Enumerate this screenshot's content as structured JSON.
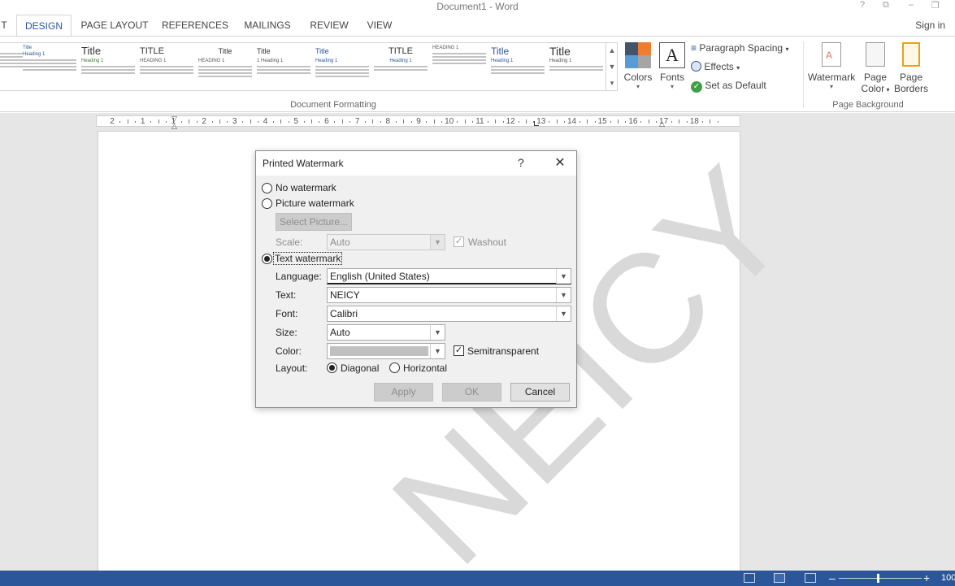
{
  "window": {
    "title": "Document1 - Word",
    "controls": [
      "?",
      "⧉",
      "–",
      "❐"
    ]
  },
  "tabs": [
    "T",
    "DESIGN",
    "PAGE LAYOUT",
    "REFERENCES",
    "MAILINGS",
    "REVIEW",
    "VIEW"
  ],
  "active_tab": "DESIGN",
  "sign_in": "Sign in",
  "ribbon": {
    "style_thumbs": [
      {
        "t1": "",
        "t2": "Title"
      },
      {
        "t1": "Title",
        "t2": "Heading 1"
      },
      {
        "t1": "TITLE",
        "t2": "HEADING 1"
      },
      {
        "t1": "Title",
        "t2": "HEADING 1"
      },
      {
        "t1": "Title",
        "t2": "1 Heading 1"
      },
      {
        "t1": "Title",
        "t2": "Heading 1"
      },
      {
        "t1": "TITLE",
        "t2": "Heading 1"
      },
      {
        "t1": "",
        "t2": "HEADING 1"
      },
      {
        "t1": "TITLE",
        "t2": ""
      },
      {
        "t1": "Title",
        "t2": "Heading 1"
      },
      {
        "t1": "Title",
        "t2": "Heading 1"
      }
    ],
    "colors_label": "Colors",
    "fonts_label": "Fonts",
    "paragraph_spacing_label": "Paragraph Spacing",
    "effects_label": "Effects",
    "set_default_label": "Set as Default",
    "document_formatting_label": "Document Formatting",
    "watermark_label": "Watermark",
    "page_color_label1": "Page",
    "page_color_label2": "Color",
    "page_borders_label1": "Page",
    "page_borders_label2": "Borders",
    "page_background_label": "Page Background"
  },
  "ruler": {
    "labels": [
      "2",
      "1",
      "1",
      "2",
      "3",
      "4",
      "5",
      "6",
      "7",
      "8",
      "9",
      "10",
      "11",
      "12",
      "13",
      "14",
      "15",
      "16",
      "17",
      "18"
    ]
  },
  "watermark_preview_text": "NEICY",
  "dialog": {
    "title": "Printed Watermark",
    "help": "?",
    "close": "✕",
    "no_watermark_label": "No watermark",
    "picture_watermark_label": "Picture watermark",
    "select_picture_label": "Select Picture...",
    "scale_label": "Scale:",
    "scale_value": "Auto",
    "washout_label": "Washout",
    "text_watermark_label": "Text watermark",
    "language_label": "Language:",
    "language_value": "English (United States)",
    "text_label": "Text:",
    "text_value": "NEICY",
    "font_label": "Font:",
    "font_value": "Calibri",
    "size_label": "Size:",
    "size_value": "Auto",
    "color_label": "Color:",
    "color_value_hex": "#c0c0c0",
    "semitransparent_label": "Semitransparent",
    "layout_label": "Layout:",
    "diagonal_label": "Diagonal",
    "horizontal_label": "Horizontal",
    "apply_label": "Apply",
    "ok_label": "OK",
    "cancel_label": "Cancel",
    "selected_option": "text",
    "selected_layout": "diagonal",
    "washout_checked": true,
    "semitransparent_checked": true
  },
  "statusbar": {
    "zoom_minus": "–",
    "zoom_plus": "+",
    "zoom_level": "100"
  },
  "colors": {
    "accent": "#2b579a",
    "status_bar": "#2b579a"
  }
}
